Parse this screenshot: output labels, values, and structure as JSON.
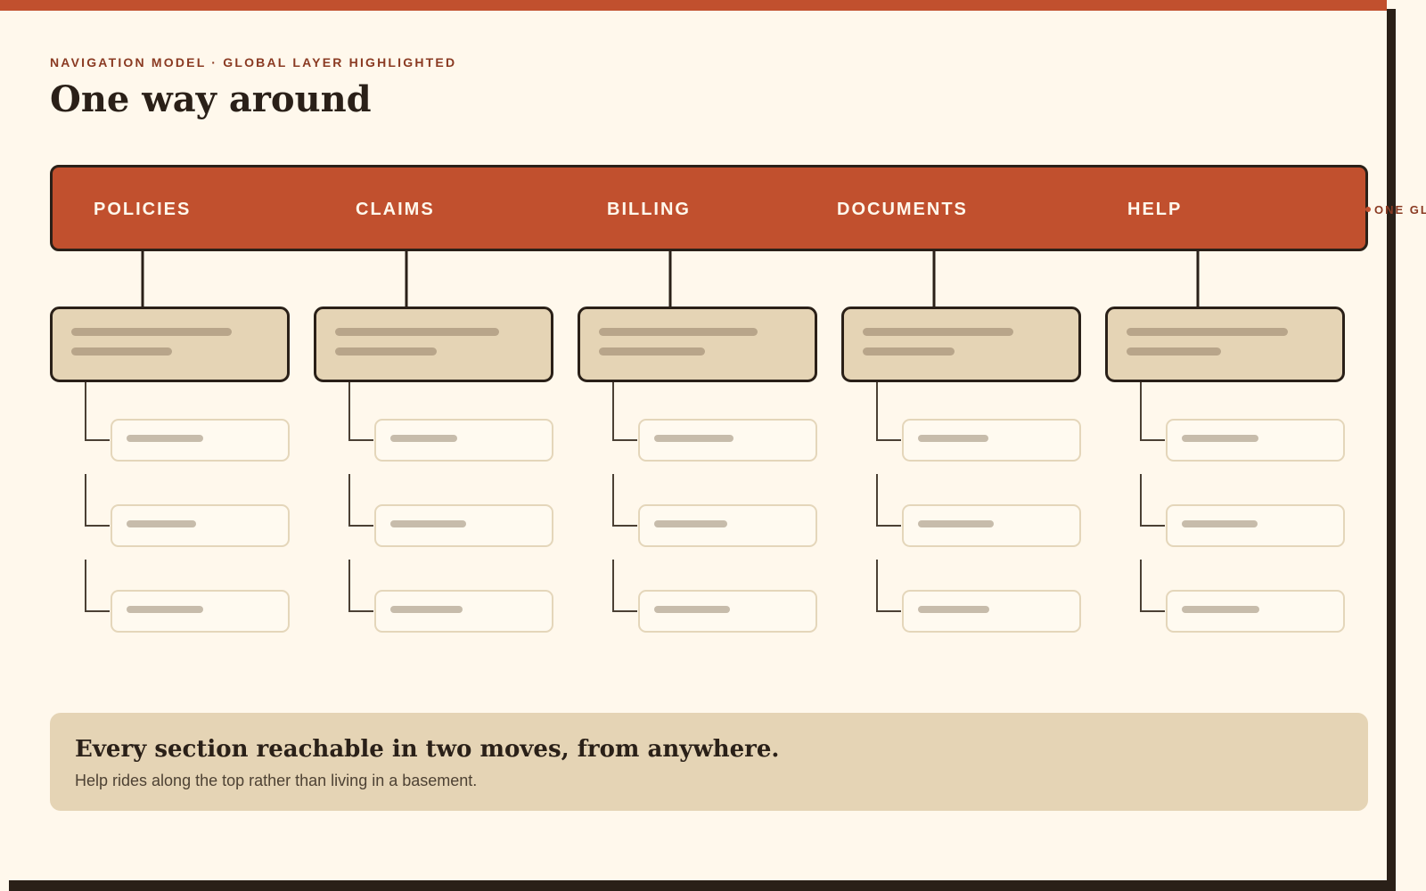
{
  "header": {
    "eyebrow": "NAVIGATION MODEL · GLOBAL LAYER HIGHLIGHTED",
    "title": "One way around"
  },
  "global_nav": {
    "items": [
      "POLICIES",
      "CLAIMS",
      "BILLING",
      "DOCUMENTS",
      "HELP"
    ],
    "side_note": "ONE GL"
  },
  "sections": [
    {
      "name": "POLICIES",
      "child_pages": 3
    },
    {
      "name": "CLAIMS",
      "child_pages": 3
    },
    {
      "name": "BILLING",
      "child_pages": 3
    },
    {
      "name": "DOCUMENTS",
      "child_pages": 3
    },
    {
      "name": "HELP",
      "child_pages": 3
    }
  ],
  "summary": {
    "headline": "Every section reachable in two moves, from anywhere.",
    "subtext": "Help rides along the top rather than living in a basement."
  },
  "colors": {
    "accent": "#c1502e",
    "ink": "#2a2018",
    "page": "#fff8ec",
    "section_fill": "#e5d4b5",
    "section_bar": "#b8a58a",
    "child_border": "#e4d6ba",
    "child_bar": "#c7bcab"
  }
}
